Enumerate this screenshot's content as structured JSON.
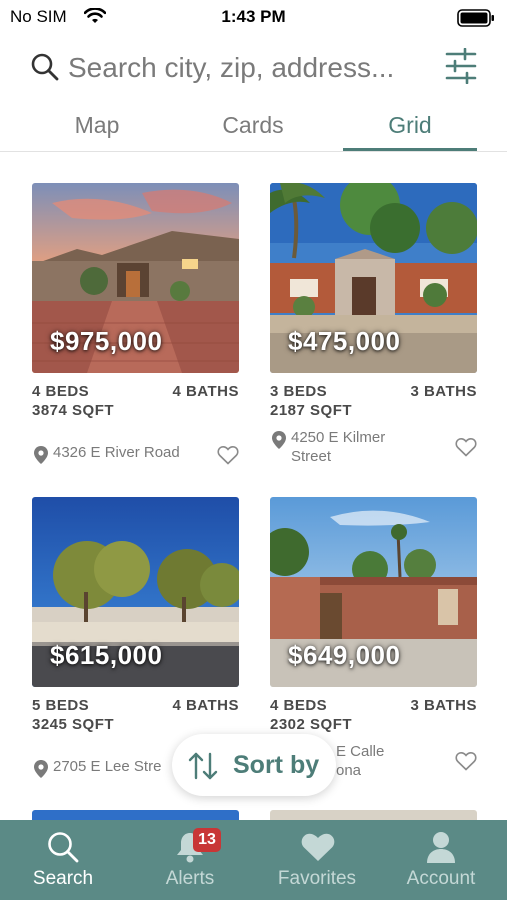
{
  "status_bar": {
    "carrier": "No SIM",
    "time": "1:43 PM"
  },
  "search": {
    "placeholder": "Search city, zip, address..."
  },
  "view_tabs": [
    {
      "label": "Map",
      "active": false
    },
    {
      "label": "Cards",
      "active": false
    },
    {
      "label": "Grid",
      "active": true
    }
  ],
  "listings": [
    {
      "price": "$975,000",
      "beds": "4 BEDS",
      "baths": "4 BATHS",
      "sqft": "3874 SQFT",
      "address": "4326 E River Road"
    },
    {
      "price": "$475,000",
      "beds": "3 BEDS",
      "baths": "3 BATHS",
      "sqft": "2187 SQFT",
      "address": "4250 E Kilmer Street"
    },
    {
      "price": "$615,000",
      "beds": "5 BEDS",
      "baths": "4 BATHS",
      "sqft": "3245 SQFT",
      "address": "2705 E Lee Stre"
    },
    {
      "price": "$649,000",
      "beds": "4 BEDS",
      "baths": "3 BATHS",
      "sqft": "2302 SQFT",
      "address": "E Calle\nona"
    }
  ],
  "sort_button": {
    "label": "Sort by"
  },
  "tab_bar": {
    "items": [
      {
        "label": "Search",
        "icon": "search-icon",
        "active": true
      },
      {
        "label": "Alerts",
        "icon": "bell-icon",
        "badge": "13",
        "active": false
      },
      {
        "label": "Favorites",
        "icon": "heart-icon",
        "active": false
      },
      {
        "label": "Account",
        "icon": "person-icon",
        "active": false
      }
    ]
  },
  "colors": {
    "accent": "#4d7d78",
    "tab_bar_bg": "#5b8a86",
    "badge": "#c83636"
  }
}
